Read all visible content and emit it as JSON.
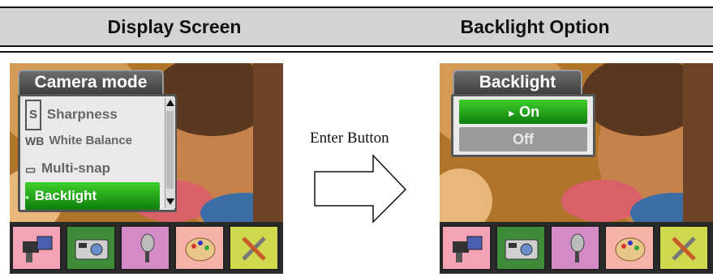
{
  "header": {
    "left_title": "Display Screen",
    "right_title": "Backlight Option"
  },
  "left_screen": {
    "menu_title": "Camera mode",
    "items": [
      {
        "icon": "S",
        "label": "Sharpness",
        "selected": false
      },
      {
        "icon": "WB",
        "label": "White Balance",
        "selected": false
      },
      {
        "icon": "▭",
        "label": "Multi-snap",
        "selected": false
      },
      {
        "icon": "▪",
        "label": "Backlight",
        "selected": true
      }
    ]
  },
  "transition": {
    "label": "Enter Button"
  },
  "right_screen": {
    "menu_title": "Backlight",
    "options": [
      {
        "label": "On",
        "selected": true
      },
      {
        "label": "Off",
        "selected": false
      }
    ]
  },
  "tabs": [
    {
      "name": "video-camera-icon",
      "color": "#f3a3b3"
    },
    {
      "name": "camera-icon",
      "color": "#3e8b3a"
    },
    {
      "name": "microphone-icon",
      "color": "#d58ac8"
    },
    {
      "name": "palette-icon",
      "color": "#f6b1a8"
    },
    {
      "name": "tools-icon",
      "color": "#cfd84e"
    }
  ]
}
